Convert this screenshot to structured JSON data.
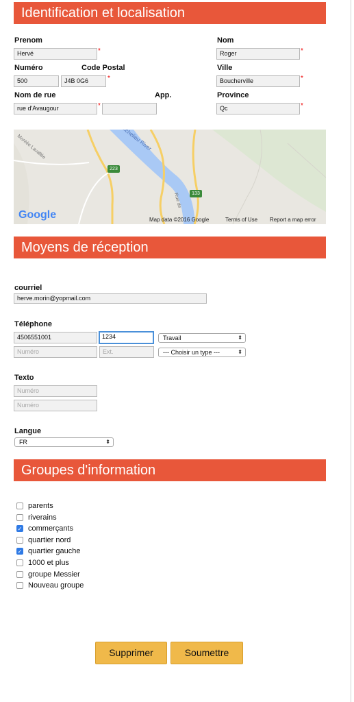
{
  "sections": {
    "identification": "Identification et localisation",
    "reception": "Moyens de réception",
    "groups": "Groupes d'information"
  },
  "identification": {
    "prenom": {
      "label": "Prenom",
      "value": "Hervé"
    },
    "nom": {
      "label": "Nom",
      "value": "Roger"
    },
    "numero": {
      "label": "Numéro",
      "value": "500"
    },
    "code_postal": {
      "label": "Code Postal",
      "value": "J4B 0G6"
    },
    "ville": {
      "label": "Ville",
      "value": "Boucherville"
    },
    "rue": {
      "label": "Nom de rue",
      "value": "rue d'Avaugour"
    },
    "app": {
      "label": "App.",
      "value": ""
    },
    "province": {
      "label": "Province",
      "value": "Qc"
    },
    "required_mark": "*"
  },
  "map": {
    "road_223": "223",
    "road_133": "133",
    "river": "Richelieu River",
    "montee": "Montée Lavallée",
    "rue_label": "Rue de",
    "logo": "Google",
    "attribution": "Map data ©2016 Google",
    "terms": "Terms of Use",
    "report": "Report a map error",
    "colors": {
      "land": "#e9e7e1",
      "water": "#a9c9f5",
      "road": "#f6cf65",
      "park": "#cfe2bd"
    }
  },
  "reception": {
    "courriel": {
      "label": "courriel",
      "value": "herve.morin@yopmail.com"
    },
    "telephone": {
      "label": "Téléphone",
      "rows": [
        {
          "numero": "4506551001",
          "ext": "1234",
          "type": "Travail"
        },
        {
          "numero_placeholder": "Numéro",
          "ext_placeholder": "Ext.",
          "type": "--- Choisir un type ---"
        }
      ]
    },
    "texto": {
      "label": "Texto",
      "placeholder1": "Numéro",
      "placeholder2": "Numéro"
    },
    "langue": {
      "label": "Langue",
      "value": "FR"
    }
  },
  "groups": [
    {
      "label": "parents",
      "checked": false
    },
    {
      "label": "riverains",
      "checked": false
    },
    {
      "label": "commerçants",
      "checked": true
    },
    {
      "label": "quartier nord",
      "checked": false
    },
    {
      "label": "quartier gauche",
      "checked": true
    },
    {
      "label": "1000 et plus",
      "checked": false
    },
    {
      "label": "groupe Messier",
      "checked": false
    },
    {
      "label": "Nouveau groupe",
      "checked": false
    }
  ],
  "buttons": {
    "delete": "Supprimer",
    "submit": "Soumettre"
  },
  "colors": {
    "header": "#e8573a",
    "button": "#f0b94a",
    "checkbox_on": "#2f7ae5",
    "required": "#e00000"
  }
}
